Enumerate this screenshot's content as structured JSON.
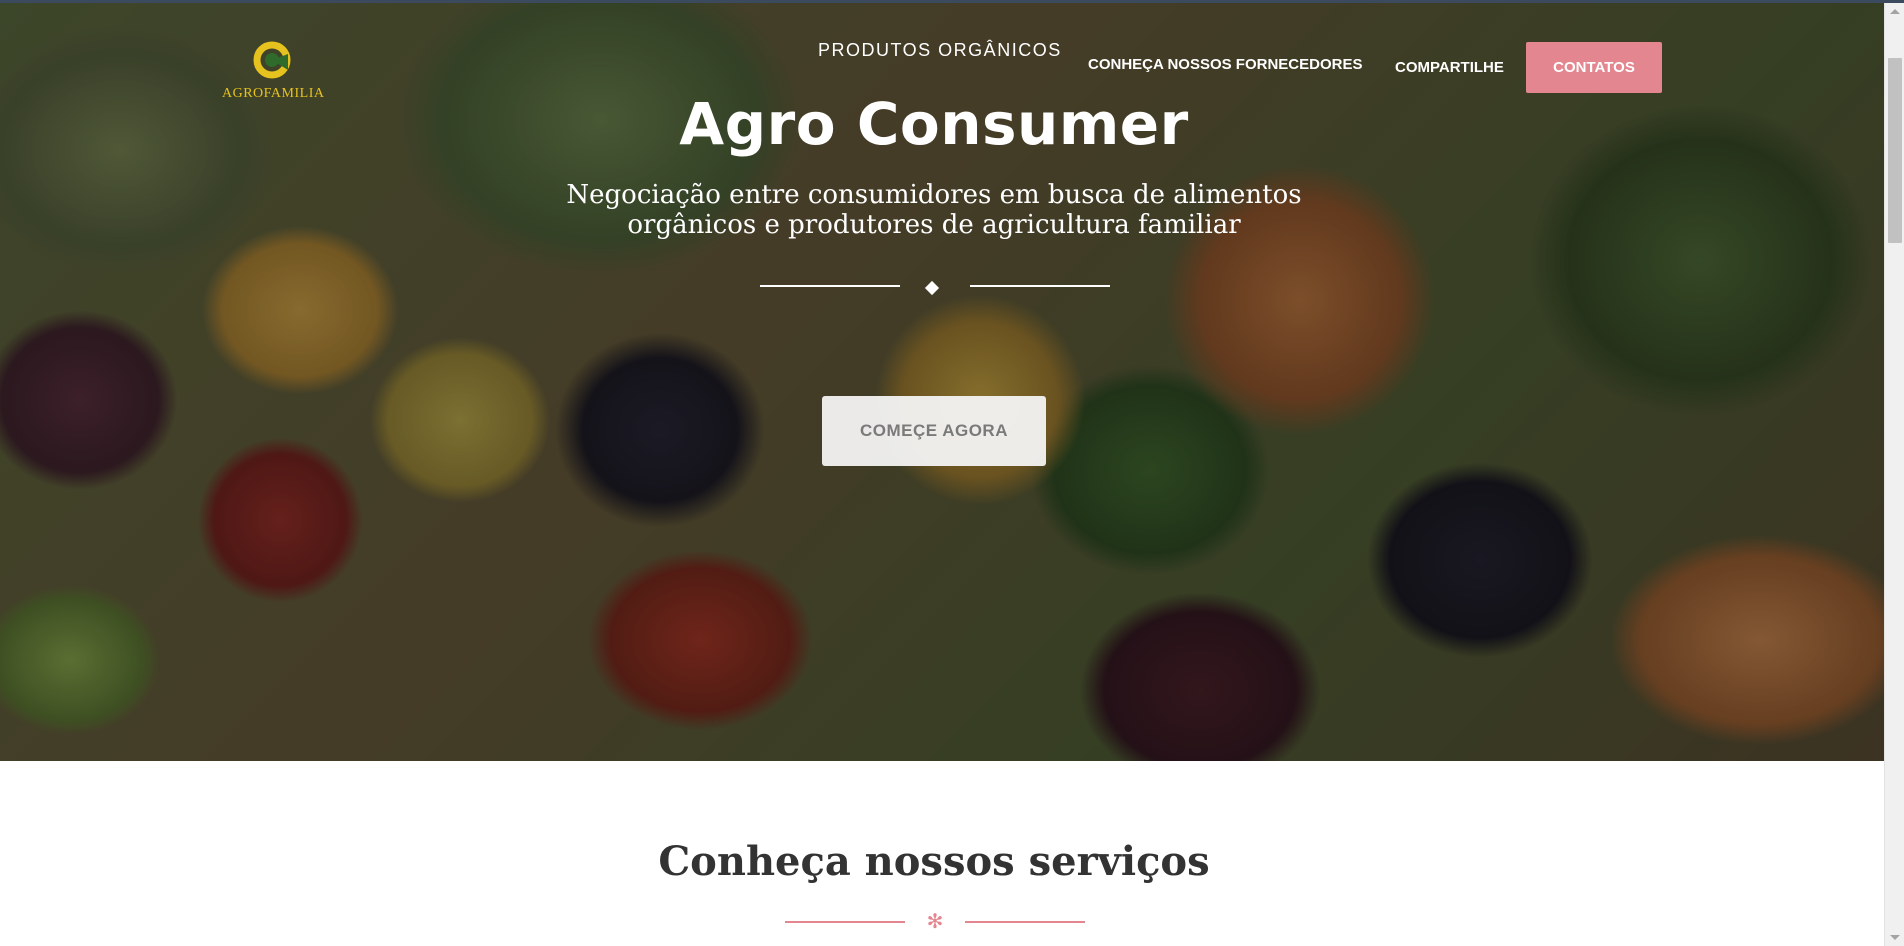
{
  "brand": {
    "logo_text": "AGROFAMILIA",
    "accent_color": "#e4868f",
    "logo_color": "#e6c21e"
  },
  "nav": {
    "produtos": "PRODUTOS ORGÂNICOS",
    "fornecedores": "CONHEÇA NOSSOS FORNECEDORES",
    "compartilhe": "COMPARTILHE",
    "contatos": "CONTATOS"
  },
  "hero": {
    "title": "Agro Consumer",
    "subtitle": "Negociação entre consumidores em busca de alimentos orgânicos e produtores de agricultura familiar",
    "cta_label": "COMEÇE AGORA"
  },
  "services": {
    "title": "Conheça nossos serviços",
    "divider_glyph": "✻"
  }
}
